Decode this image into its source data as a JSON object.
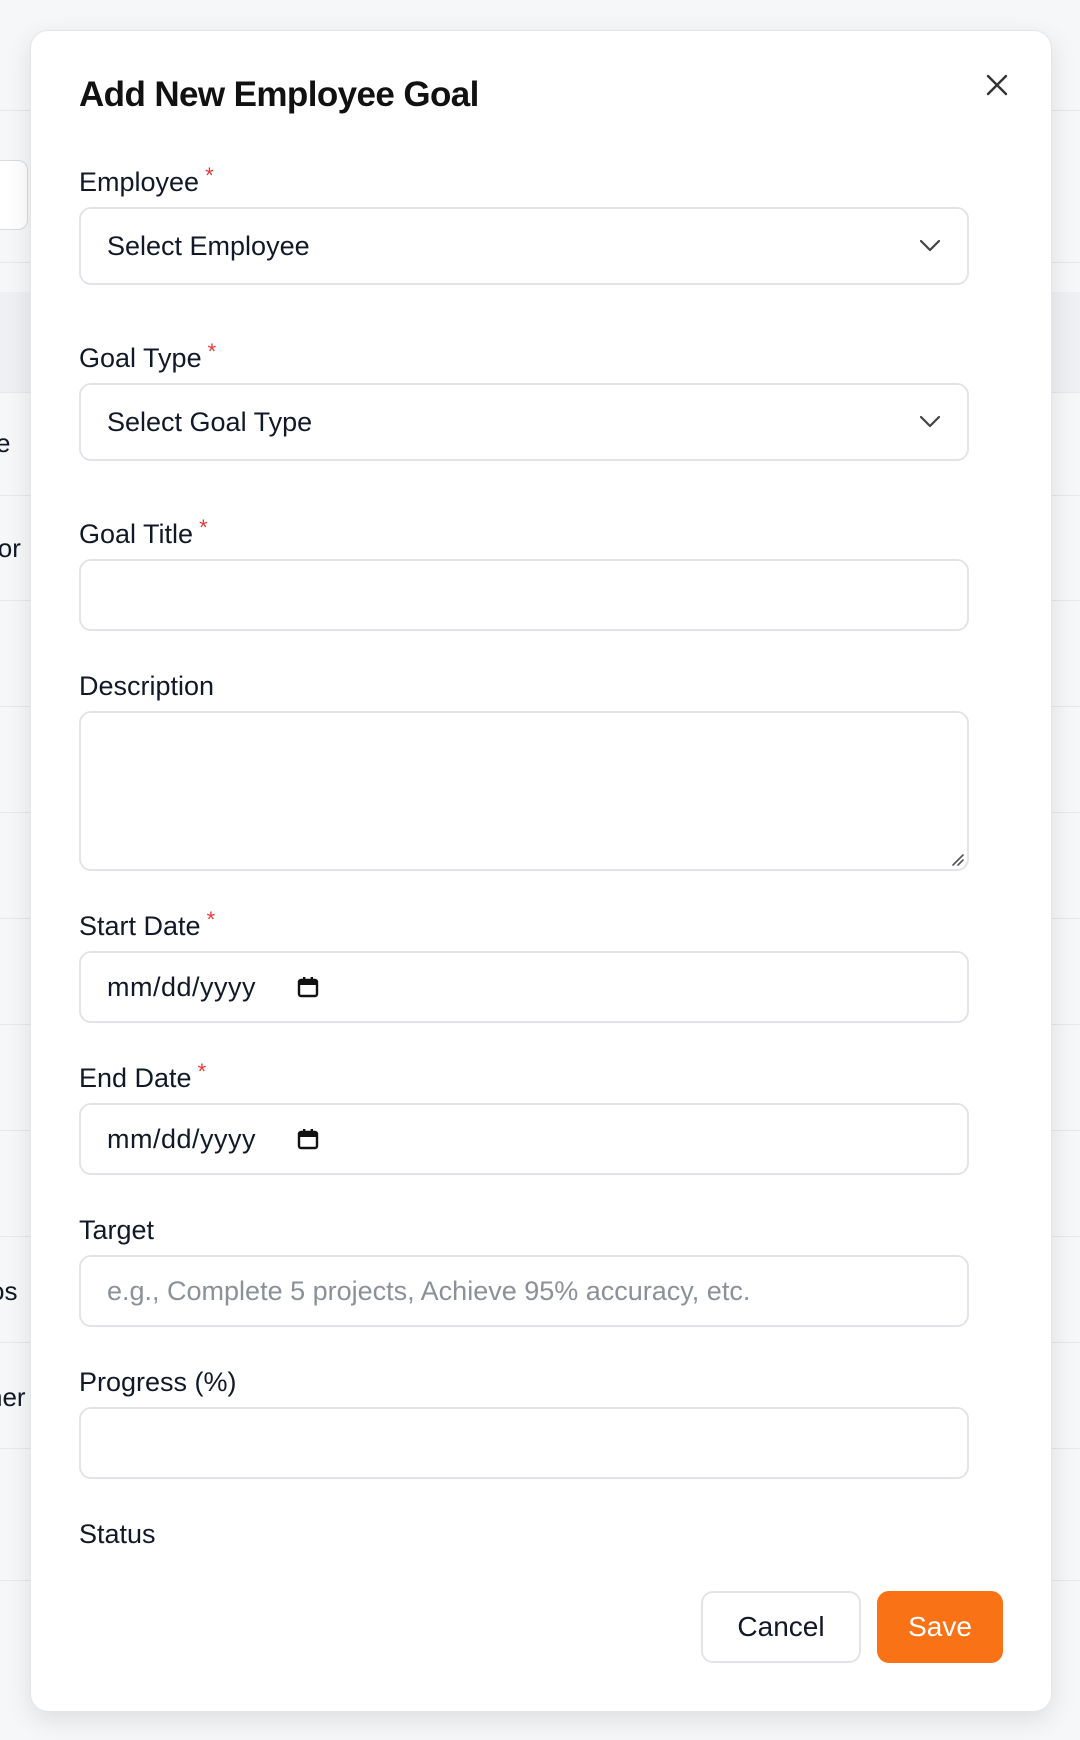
{
  "background_fragments": [
    "e",
    "ior",
    "os",
    "ner"
  ],
  "modal": {
    "title": "Add New Employee Goal",
    "close_icon": "close-icon"
  },
  "fields": {
    "employee": {
      "label": "Employee",
      "required": "*",
      "value": "Select Employee"
    },
    "goal_type": {
      "label": "Goal Type",
      "required": "*",
      "value": "Select Goal Type"
    },
    "goal_title": {
      "label": "Goal Title",
      "required": "*",
      "value": ""
    },
    "description": {
      "label": "Description",
      "value": ""
    },
    "start_date": {
      "label": "Start Date",
      "required": "*",
      "value": "mm/dd/yyyy"
    },
    "end_date": {
      "label": "End Date",
      "required": "*",
      "value": "mm/dd/yyyy"
    },
    "target": {
      "label": "Target",
      "placeholder": "e.g., Complete 5 projects, Achieve 95% accuracy, etc."
    },
    "progress": {
      "label": "Progress (%)",
      "value": ""
    },
    "status": {
      "label": "Status"
    }
  },
  "buttons": {
    "cancel": "Cancel",
    "save": "Save"
  },
  "colors": {
    "accent": "#f97316",
    "required": "#e53935",
    "border": "#e2e4e8"
  }
}
